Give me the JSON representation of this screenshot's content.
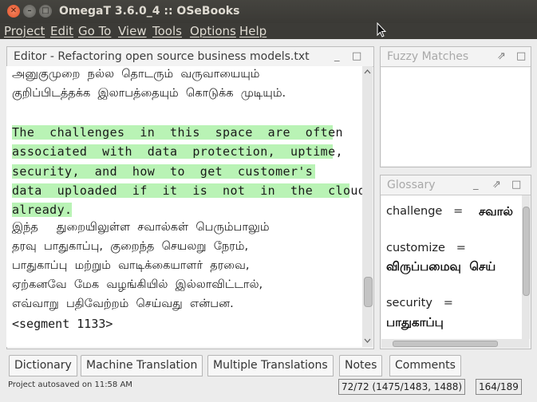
{
  "window": {
    "title": "OmegaT 3.6.0_4 :: OSeBooks",
    "close_glyph": "✕",
    "min_glyph": "–",
    "max_glyph": "□"
  },
  "menu": [
    "Project",
    "Edit",
    "Go To",
    "View",
    "Tools",
    "Options",
    "Help"
  ],
  "editor": {
    "title": "Editor - Refactoring open source business models.txt",
    "min_glyph": "_",
    "max_glyph": "□",
    "prev_target_lines": [
      "அனுகுமுறை  நல்ல  தொடரும்  வருவாயையும்",
      "குறிப்பிடத்தக்க  இலாபத்தையும்  கொடுக்க  முடியும்."
    ],
    "active_source_lines": [
      "The  challenges  in  this  space  are  often",
      "associated  with  data  protection,  uptime,",
      "security,  and  how  to  get  customer's",
      "data  uploaded  if  it  is  not  in  the  cloud",
      "already."
    ],
    "target_lines": [
      "இந்த     துறையிலுள்ள  சவால்கள்  பெரும்பாலும்",
      "தரவு  பாதுகாப்பு,  குறைந்த  செயலறு  நேரம்,",
      "பாதுகாப்பு  மற்றும்  வாடிக்கையாளர்  தரவை,",
      "ஏற்கனவே  மேக  வழங்கியில்  இல்லாவிட்டால்,",
      "எவ்வாறு  பதிவேற்றம்  செய்வது  என்பன."
    ],
    "segment_marker": "<segment 1133>",
    "scroll_fraction": 0.82
  },
  "fuzzy": {
    "title": "Fuzzy Matches",
    "undock_glyph": "⇗",
    "min_glyph": "_",
    "max_glyph": "□"
  },
  "glossary": {
    "title": "Glossary",
    "undock_glyph": "⇗",
    "min_glyph": "_",
    "max_glyph": "□",
    "entries": [
      {
        "term": "challenge   =",
        "translation": "சவால்"
      },
      {
        "term": "customize   =",
        "translation": "விருப்பமைவு  செய்"
      },
      {
        "term": "security   =",
        "translation": "பாதுகாப்பு"
      }
    ]
  },
  "tabs": [
    "Dictionary",
    "Machine Translation",
    "Multiple Translations",
    "Notes",
    "Comments"
  ],
  "status": {
    "autosave": "Project autosaved on 11:58 AM",
    "progress": "72/72 (1475/1483, 1488)",
    "counts": "164/189"
  }
}
